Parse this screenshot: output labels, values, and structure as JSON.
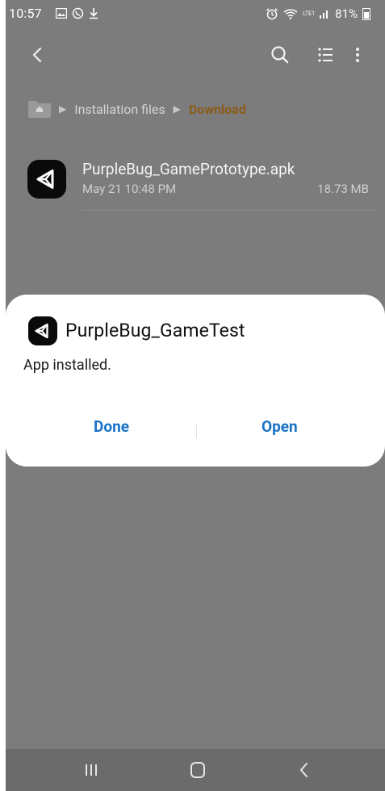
{
  "status_bar": {
    "time": "10:57",
    "battery": "81%",
    "network": "LTE1",
    "left_icons": [
      "gallery-icon",
      "whatsapp-icon",
      "download-icon"
    ],
    "right_icons": [
      "alarm-icon",
      "wifi-icon",
      "lte-icon",
      "signal-icon",
      "battery-icon"
    ]
  },
  "app_bar": {
    "back_icon": "back-arrow-icon",
    "actions": [
      "search-icon",
      "list-view-icon",
      "more-options-icon"
    ]
  },
  "breadcrumb": {
    "items": [
      "Installation files",
      "Download"
    ]
  },
  "file": {
    "name": "PurpleBug_GamePrototype.apk",
    "date": "May 21 10:48 PM",
    "size": "18.73 MB",
    "icon": "unity-icon"
  },
  "dialog": {
    "title": "PurpleBug_GameTest",
    "message": "App installed.",
    "buttons": [
      "Done",
      "Open"
    ],
    "icon": "unity-icon"
  },
  "nav_bar": {
    "icons": [
      "recent-apps-icon",
      "home-icon",
      "back-icon"
    ]
  },
  "colors": {
    "scrim_background": "#7c7c7c",
    "dialog_background": "#ffffff",
    "button_text": "#1a73c8",
    "breadcrumb_current": "#8a5d1a",
    "navbar_background": "#6b6b6b"
  }
}
